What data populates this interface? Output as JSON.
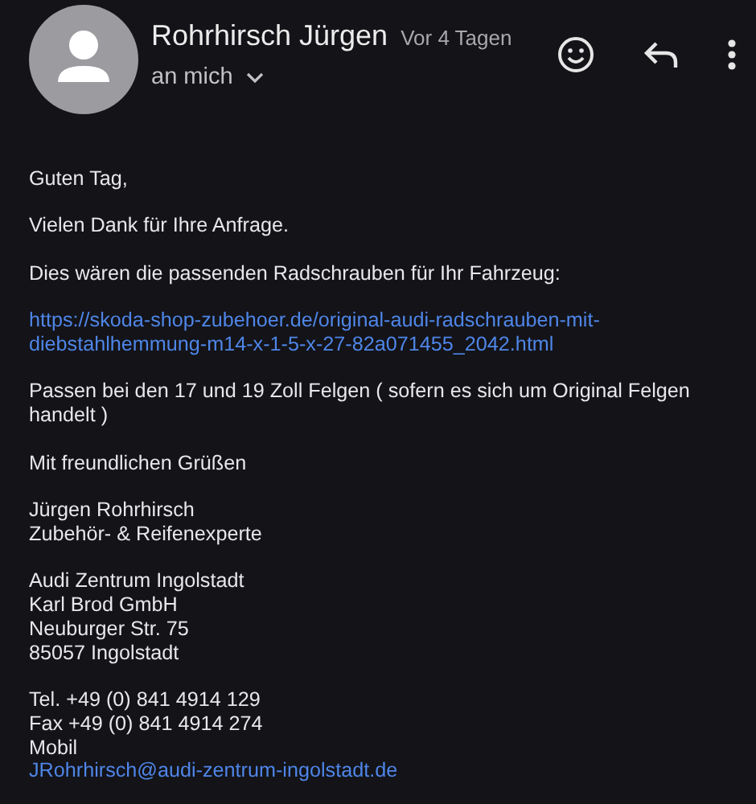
{
  "header": {
    "sender": "Rohrhirsch Jürgen",
    "time": "Vor 4 Tagen",
    "recipient": "an mich"
  },
  "body": [
    [
      {
        "kind": "text",
        "text": "Guten Tag,"
      }
    ],
    [
      {
        "kind": "text",
        "text": "Vielen Dank für Ihre Anfrage."
      }
    ],
    [
      {
        "kind": "text",
        "text": "Dies wären die passenden Radschrauben für Ihr Fahrzeug:"
      }
    ],
    [
      {
        "kind": "link",
        "text": "https://skoda-shop-zubehoer.de/original-audi-radschrauben-mit-diebstahlhemmung-m14-x-1-5-x-27-82a071455_2042.html"
      }
    ],
    [
      {
        "kind": "text",
        "text": "Passen bei den 17 und 19 Zoll Felgen ( sofern es sich um Original Felgen handelt )"
      }
    ],
    [
      {
        "kind": "text",
        "text": "Mit freundlichen Grüßen"
      }
    ],
    [
      {
        "kind": "text",
        "text": "Jürgen Rohrhirsch"
      },
      {
        "kind": "text",
        "text": "Zubehör- & Reifenexperte"
      }
    ],
    [
      {
        "kind": "text",
        "text": "Audi Zentrum Ingolstadt"
      },
      {
        "kind": "text",
        "text": "Karl Brod GmbH"
      },
      {
        "kind": "text",
        "text": "Neuburger Str. 75"
      },
      {
        "kind": "text",
        "text": "85057 Ingolstadt"
      }
    ],
    [
      {
        "kind": "text",
        "text": "Tel. +49 (0) 841 4914 129"
      },
      {
        "kind": "text",
        "text": "Fax +49 (0) 841 4914 274"
      },
      {
        "kind": "text",
        "text": "Mobil"
      },
      {
        "kind": "link",
        "text": "JRohrhirsch@audi-zentrum-ingolstadt.de"
      }
    ]
  ]
}
